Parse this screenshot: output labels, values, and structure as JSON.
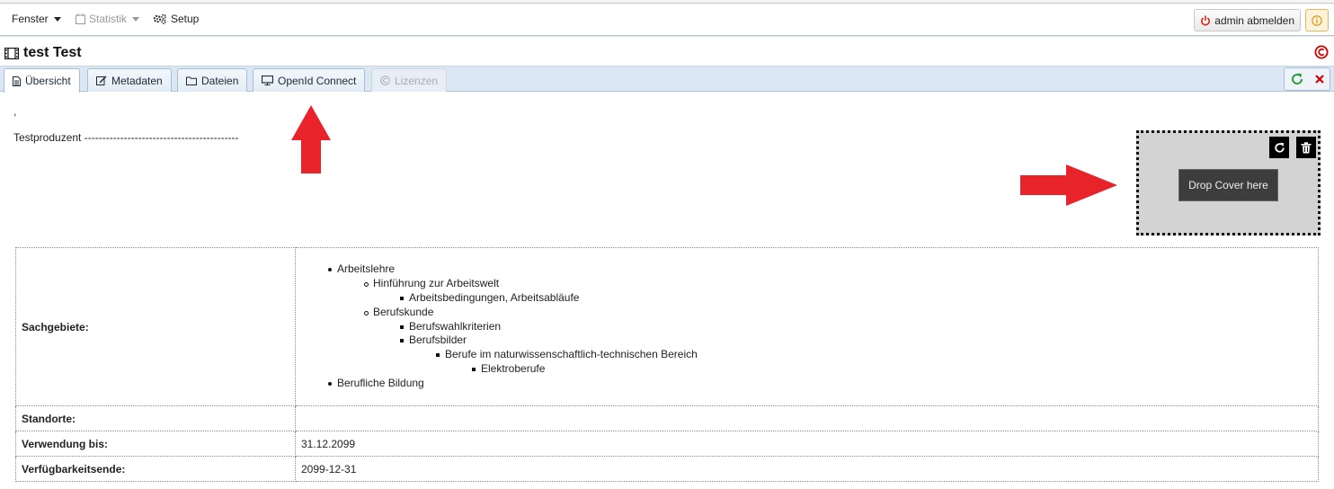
{
  "menubar": {
    "fenster": "Fenster",
    "statistik": "Statistik",
    "setup": "Setup",
    "logout_label": "admin abmelden"
  },
  "title": "test Test",
  "tabs": [
    {
      "label": "Übersicht",
      "icon": "file-icon",
      "state": "active"
    },
    {
      "label": "Metadaten",
      "icon": "edit-icon",
      "state": "normal"
    },
    {
      "label": "Dateien",
      "icon": "folder-icon",
      "state": "normal"
    },
    {
      "label": "OpenId Connect",
      "icon": "monitor-icon",
      "state": "normal"
    },
    {
      "label": "Lizenzen",
      "icon": "copyright-icon",
      "state": "disabled"
    }
  ],
  "content": {
    "comma": ",",
    "producer": "Testproduzent -------------------------------------------",
    "drop_cover": "Drop Cover here"
  },
  "table": {
    "sachgebiete_label": "Sachgebiete:",
    "sachgebiete_items": [
      {
        "text": "Arbeitslehre",
        "level": 1
      },
      {
        "text": "Hinführung zur Arbeitswelt",
        "level": 2
      },
      {
        "text": "Arbeitsbedingungen, Arbeitsabläufe",
        "level": 3
      },
      {
        "text": "Berufskunde",
        "level": 2
      },
      {
        "text": "Berufswahlkriterien",
        "level": 3
      },
      {
        "text": "Berufsbilder",
        "level": 3
      },
      {
        "text": "Berufe im naturwissenschaftlich-technischen Bereich",
        "level": 4
      },
      {
        "text": "Elektroberufe",
        "level": 5
      },
      {
        "text": "Berufliche Bildung",
        "level": 1
      }
    ],
    "standorte_label": "Standorte:",
    "standorte_value": "",
    "verwendung_label": "Verwendung bis:",
    "verwendung_value": "31.12.2099",
    "verfuegbarkeit_label": "Verfügbarkeitsende:",
    "verfuegbarkeit_value": "2099-12-31"
  },
  "colors": {
    "tabbar_bg": "#dbe7f4",
    "arrow_red": "#e8232a",
    "logout_icon": "#d9281e",
    "reload_green": "#2a9d3a",
    "close_red": "#d40000"
  }
}
